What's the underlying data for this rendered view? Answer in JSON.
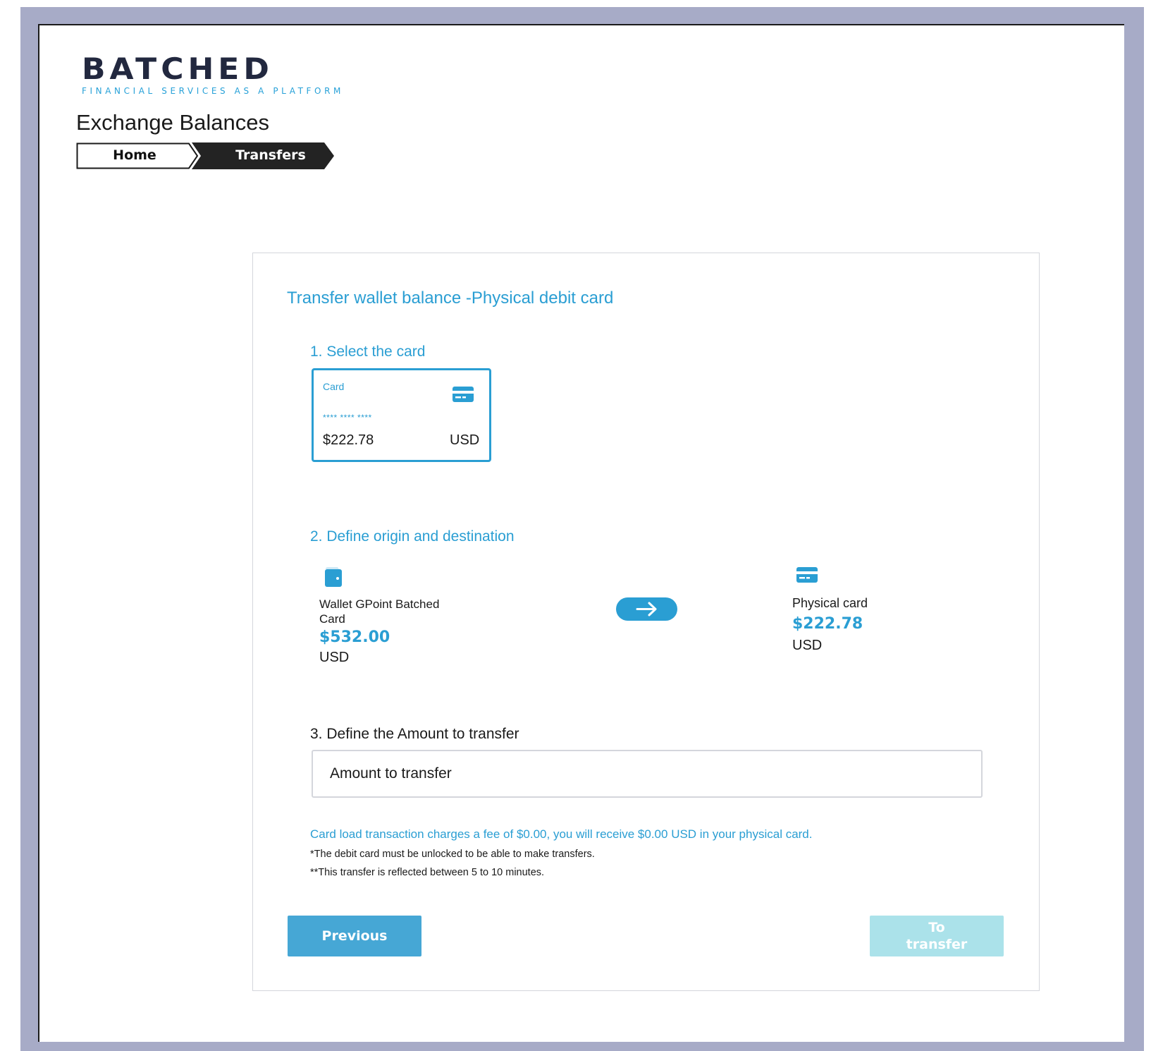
{
  "brand": {
    "name": "BATCHED",
    "tagline": "FINANCIAL SERVICES AS A PLATFORM"
  },
  "page": {
    "title": "Exchange Balances"
  },
  "breadcrumb": {
    "items": [
      "Home",
      "Transfers"
    ]
  },
  "form": {
    "title": "Transfer wallet balance -Physical debit card",
    "step1": {
      "label": "1. Select the card",
      "card": {
        "label": "Card",
        "icon": "credit-card-icon",
        "masked_number": "**** **** ****",
        "amount": "$222.78",
        "currency": "USD"
      }
    },
    "step2": {
      "label": "2. Define origin and destination",
      "origin": {
        "icon": "wallet-icon",
        "name": "Wallet GPoint Batched Card",
        "amount": "$532.00",
        "currency": "USD"
      },
      "arrow_icon": "arrow-right-icon",
      "destination": {
        "icon": "credit-card-icon",
        "name": "Physical card",
        "amount": "$222.78",
        "currency": "USD"
      }
    },
    "step3": {
      "label": "3. Define the Amount to transfer",
      "amount_placeholder": "Amount to transfer",
      "amount_value": ""
    },
    "fee_note": "Card load transaction charges a fee of $0.00, you will receive $0.00 USD in your physical card.",
    "notes": [
      "*The debit card must be unlocked to be able to make transfers.",
      "**This transfer is reflected between 5 to 10 minutes."
    ],
    "buttons": {
      "previous": "Previous",
      "transfer": "To transfer"
    }
  },
  "colors": {
    "accent": "#2a9ed3",
    "frame": "#a7abc7",
    "button_primary": "#46a7d5",
    "button_disabled": "#abe2ea",
    "logo_dark": "#22283f"
  }
}
